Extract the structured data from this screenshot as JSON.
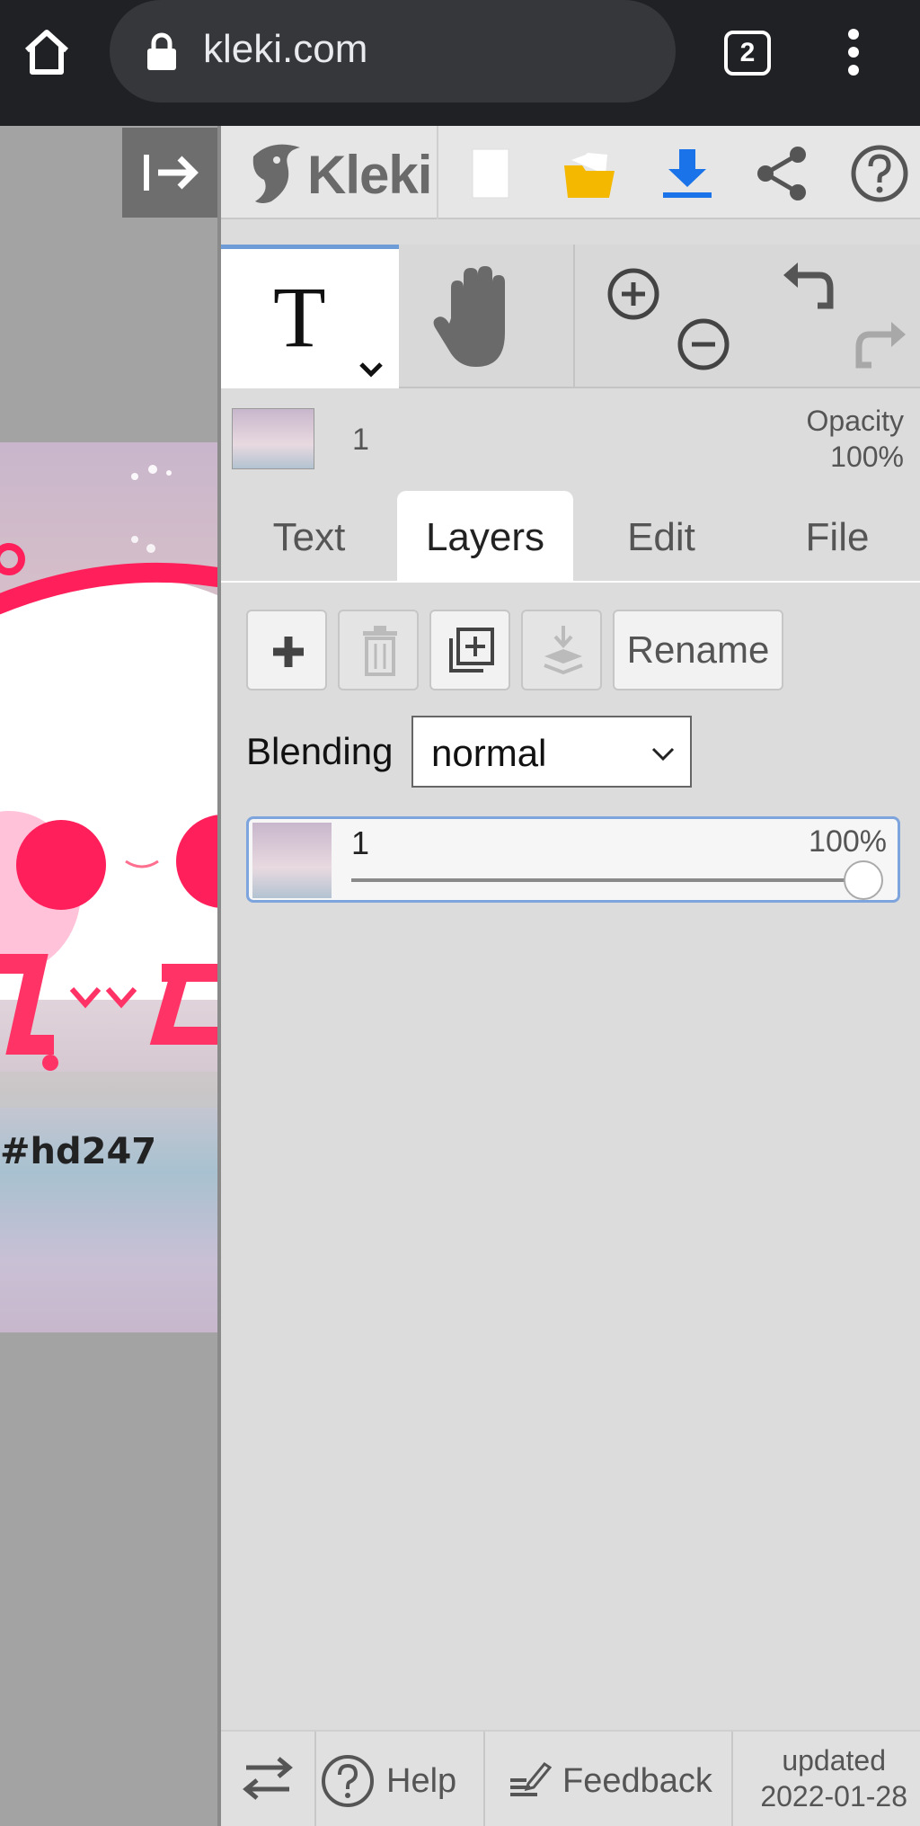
{
  "browser": {
    "url": "kleki.com",
    "tab_count": "2"
  },
  "canvas": {
    "artwork_caption": "#hd247"
  },
  "app": {
    "logo_text": "Kleki"
  },
  "tools": {
    "text_tool_glyph": "T"
  },
  "current_layer": {
    "name": "1",
    "opacity_label": "Opacity",
    "opacity_value": "100%"
  },
  "tabs": [
    {
      "label": "Text"
    },
    {
      "label": "Layers"
    },
    {
      "label": "Edit"
    },
    {
      "label": "File"
    }
  ],
  "active_tab": "Layers",
  "layers_panel": {
    "rename_label": "Rename",
    "blending_label": "Blending",
    "blending_value": "normal",
    "layers": [
      {
        "name": "1",
        "opacity": "100%",
        "opacity_fraction": 1.0
      }
    ]
  },
  "footer": {
    "help_label": "Help",
    "feedback_label": "Feedback",
    "updated_label": "updated",
    "updated_date": "2022-01-28"
  },
  "colors": {
    "accent": "#6e9cd6",
    "download_blue": "#1a73e8",
    "folder_yellow": "#f5b800",
    "artwork_pink": "#ff1f5a"
  }
}
